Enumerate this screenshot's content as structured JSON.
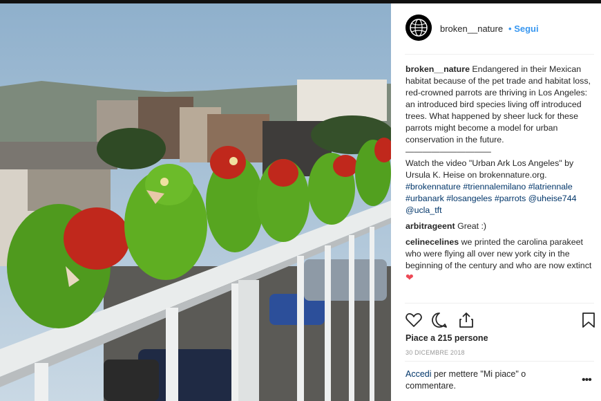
{
  "post": {
    "username": "broken__nature",
    "follow_label": "Segui",
    "follow_sep": "•",
    "caption_text": "Endangered in their Mexican habitat because of the pet trade and habitat loss, red-crowned parrots are thriving in Los Angeles: an introduced bird species living off introduced trees. What happened by sheer luck for these parrots might become a model for urban conservation in the future.",
    "caption_divider": "——————————",
    "caption_video": "Watch the video \"Urban Ark Los Angeles\" by Ursula K. Heise on brokennature.org.",
    "caption_tags": "#brokennature #triennalemilano #latriennale #urbanark #losangeles #parrots @uheise744 @ucla_tft"
  },
  "comments": [
    {
      "user": "arbitrageent",
      "text": "Great :)"
    },
    {
      "user": "celinecelines",
      "text": "we printed the carolina parakeet who were flying all over new york city in the beginning of the century and who are now extinct",
      "emoji": "❤"
    }
  ],
  "actions": {
    "like_icon": "heart-outline-icon",
    "comment_icon": "speech-bubble-icon",
    "share_icon": "share-icon",
    "save_icon": "bookmark-icon"
  },
  "likes_label": "Piace a 215 persone",
  "date_label": "30 DICEMBRE 2018",
  "login": {
    "link": "Accedi",
    "text": "per mettere \"Mi piace\" o commentare."
  },
  "more_label": "•••",
  "colors": {
    "link": "#3897f0",
    "tag": "#003569",
    "heart": "#ed4956"
  }
}
